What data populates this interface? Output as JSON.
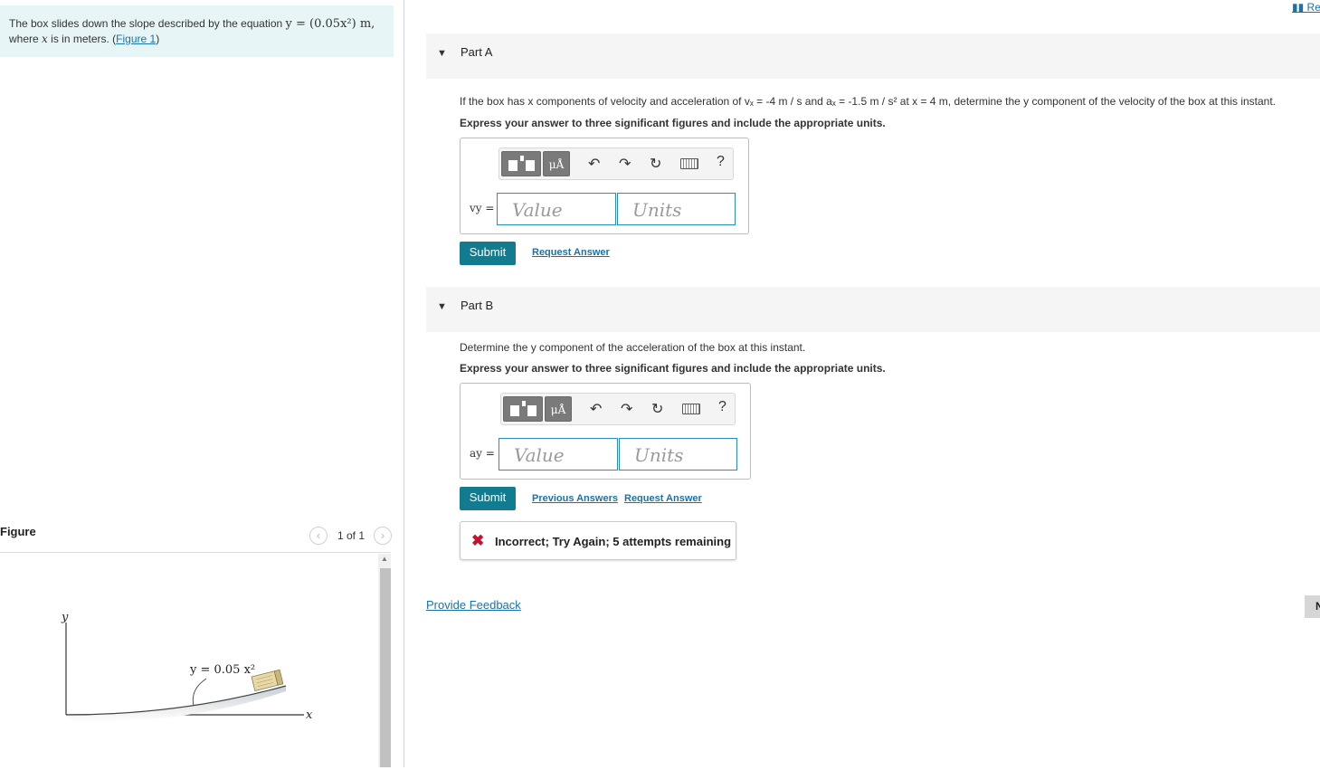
{
  "problem": {
    "text_prefix": "The box slides down the slope described by the equation",
    "equation": "y = (0.05x²) m,",
    "text_line2_a": "where",
    "text_line2_var": "x",
    "text_line2_b": "is in meters. (",
    "figure_link": "Figure 1",
    "text_line2_c": ")"
  },
  "figure": {
    "title": "Figure",
    "count": "1 of 1",
    "prev_icon": "chevron-left-icon",
    "next_icon": "chevron-right-icon",
    "y_axis_label": "y",
    "x_axis_label": "x",
    "curve_label": "y = 0.05 x²"
  },
  "header": {
    "top_right_link": "Re"
  },
  "part_a": {
    "title": "Part A",
    "question": "If the box has x components of velocity and acceleration of vₓ = -4 m / s and aₓ = -1.5 m / s² at x = 4 m, determine the y component of the velocity of the box at this instant.",
    "instructions": "Express your answer to three significant figures and include the appropriate units.",
    "var_label": "vy =",
    "value_placeholder": "Value",
    "units_placeholder": "Units",
    "submit": "Submit",
    "request_answer": "Request Answer"
  },
  "part_b": {
    "title": "Part B",
    "question": "Determine the y component of the acceleration of the box at this instant.",
    "instructions": "Express your answer to three significant figures and include the appropriate units.",
    "var_label": "ay =",
    "value_placeholder": "Value",
    "units_placeholder": "Units",
    "submit": "Submit",
    "previous_answers": "Previous Answers",
    "request_answer": "Request Answer",
    "error_message": "Incorrect; Try Again; 5 attempts remaining"
  },
  "toolbar": {
    "mu_label": "μÅ",
    "help": "?"
  },
  "footer": {
    "provide_feedback": "Provide Feedback",
    "side_tab": "N"
  },
  "colors": {
    "accent": "#127b8f",
    "link": "#1a73a8",
    "error": "#c8102e",
    "problem_bg": "#e8f5f7"
  }
}
